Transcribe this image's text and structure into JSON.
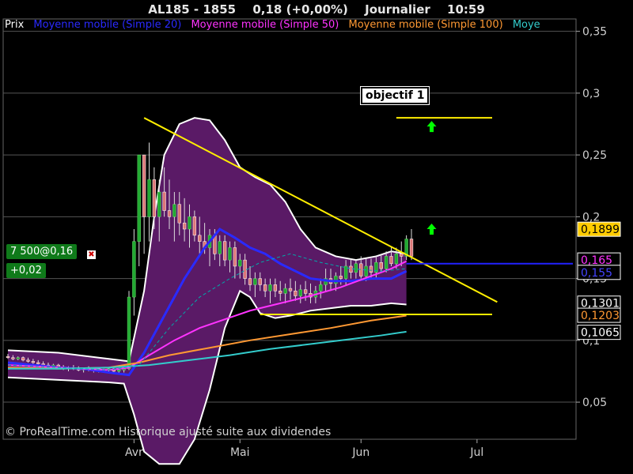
{
  "header": {
    "symbol": "AL185 - 1855",
    "price_change": "0,18 (+0,00%)",
    "period": "Journalier",
    "time": "10:59"
  },
  "legend": {
    "items": [
      {
        "label": "Prix",
        "color": "#ffffff"
      },
      {
        "label": "Moyenne mobile (Simple 20)",
        "color": "#2a2aff"
      },
      {
        "label": "Moyenne mobile (Simple 50)",
        "color": "#ff33ff"
      },
      {
        "label": "Moyenne mobile (Simple 100)",
        "color": "#ff9933"
      },
      {
        "label": "Moye",
        "color": "#33cccc"
      }
    ]
  },
  "order_box": {
    "label": "7 500@0,16",
    "change": "+0,02"
  },
  "annotation": {
    "label": "objectif 1"
  },
  "copyright": "© ProRealTime.com Historique ajusté suite aux dividendes",
  "chart_data": {
    "type": "candlestick",
    "y_axis": {
      "ylim": [
        0.02,
        0.36
      ],
      "ticks": [
        {
          "value": 0.35,
          "label": "0,35"
        },
        {
          "value": 0.3,
          "label": "0,3"
        },
        {
          "value": 0.25,
          "label": "0,25"
        },
        {
          "value": 0.2,
          "label": "0,2"
        },
        {
          "value": 0.15,
          "label": "0,15"
        },
        {
          "value": 0.1,
          "label": "0,1"
        },
        {
          "value": 0.05,
          "label": "0,05"
        }
      ]
    },
    "x_axis": {
      "ticks": [
        {
          "label": "Avr",
          "index": 25
        },
        {
          "label": "Mai",
          "index": 46
        },
        {
          "label": "Jun",
          "index": 70
        },
        {
          "label": "Jul",
          "index": 93
        }
      ],
      "range": [
        0,
        112
      ]
    },
    "price_labels": [
      {
        "value": 0.1899,
        "label": "0,1899",
        "bg": "#ffcc00",
        "fg": "#000000"
      },
      {
        "value": 0.165,
        "label": "0,165",
        "bg": "#000000",
        "fg": "#ff33ff"
      },
      {
        "value": 0.155,
        "label": "0,155",
        "bg": "#000000",
        "fg": "#4444ff"
      },
      {
        "value": 0.1301,
        "label": "0,1301",
        "bg": "#000000",
        "fg": "#ffffff"
      },
      {
        "value": 0.1203,
        "label": "0,1203",
        "bg": "#000000",
        "fg": "#ff9933"
      },
      {
        "value": 0.1065,
        "label": "0,1065",
        "bg": "#000000",
        "fg": "#ffffff"
      }
    ],
    "candles": [
      [
        0.087,
        0.089,
        0.085,
        0.086
      ],
      [
        0.086,
        0.088,
        0.084,
        0.085
      ],
      [
        0.085,
        0.087,
        0.084,
        0.086
      ],
      [
        0.086,
        0.087,
        0.083,
        0.084
      ],
      [
        0.084,
        0.086,
        0.082,
        0.083
      ],
      [
        0.083,
        0.085,
        0.081,
        0.082
      ],
      [
        0.082,
        0.084,
        0.08,
        0.081
      ],
      [
        0.081,
        0.083,
        0.079,
        0.08
      ],
      [
        0.08,
        0.082,
        0.078,
        0.079
      ],
      [
        0.079,
        0.081,
        0.077,
        0.08
      ],
      [
        0.08,
        0.081,
        0.077,
        0.078
      ],
      [
        0.078,
        0.08,
        0.076,
        0.077
      ],
      [
        0.077,
        0.079,
        0.075,
        0.078
      ],
      [
        0.078,
        0.08,
        0.076,
        0.077
      ],
      [
        0.077,
        0.079,
        0.075,
        0.076
      ],
      [
        0.076,
        0.078,
        0.074,
        0.077
      ],
      [
        0.077,
        0.079,
        0.075,
        0.076
      ],
      [
        0.076,
        0.078,
        0.074,
        0.077
      ],
      [
        0.077,
        0.078,
        0.074,
        0.075
      ],
      [
        0.075,
        0.077,
        0.074,
        0.076
      ],
      [
        0.076,
        0.078,
        0.074,
        0.077
      ],
      [
        0.077,
        0.078,
        0.074,
        0.075
      ],
      [
        0.075,
        0.077,
        0.073,
        0.076
      ],
      [
        0.076,
        0.078,
        0.074,
        0.077
      ],
      [
        0.077,
        0.14,
        0.076,
        0.135
      ],
      [
        0.135,
        0.19,
        0.12,
        0.18
      ],
      [
        0.18,
        0.25,
        0.16,
        0.25
      ],
      [
        0.25,
        0.25,
        0.17,
        0.2
      ],
      [
        0.2,
        0.26,
        0.18,
        0.23
      ],
      [
        0.23,
        0.24,
        0.19,
        0.2
      ],
      [
        0.2,
        0.23,
        0.18,
        0.22
      ],
      [
        0.22,
        0.24,
        0.2,
        0.205
      ],
      [
        0.205,
        0.23,
        0.19,
        0.2
      ],
      [
        0.2,
        0.22,
        0.18,
        0.21
      ],
      [
        0.21,
        0.22,
        0.185,
        0.195
      ],
      [
        0.195,
        0.215,
        0.18,
        0.19
      ],
      [
        0.19,
        0.21,
        0.175,
        0.2
      ],
      [
        0.2,
        0.205,
        0.18,
        0.185
      ],
      [
        0.185,
        0.2,
        0.17,
        0.18
      ],
      [
        0.18,
        0.195,
        0.17,
        0.175
      ],
      [
        0.175,
        0.19,
        0.16,
        0.185
      ],
      [
        0.185,
        0.19,
        0.165,
        0.17
      ],
      [
        0.17,
        0.185,
        0.16,
        0.18
      ],
      [
        0.18,
        0.185,
        0.16,
        0.165
      ],
      [
        0.165,
        0.18,
        0.155,
        0.175
      ],
      [
        0.175,
        0.18,
        0.15,
        0.16
      ],
      [
        0.16,
        0.17,
        0.15,
        0.165
      ],
      [
        0.165,
        0.17,
        0.145,
        0.15
      ],
      [
        0.15,
        0.16,
        0.14,
        0.145
      ],
      [
        0.145,
        0.155,
        0.135,
        0.15
      ],
      [
        0.15,
        0.155,
        0.14,
        0.145
      ],
      [
        0.145,
        0.15,
        0.135,
        0.14
      ],
      [
        0.14,
        0.15,
        0.13,
        0.145
      ],
      [
        0.145,
        0.15,
        0.135,
        0.14
      ],
      [
        0.14,
        0.148,
        0.132,
        0.138
      ],
      [
        0.138,
        0.146,
        0.13,
        0.142
      ],
      [
        0.142,
        0.15,
        0.133,
        0.14
      ],
      [
        0.14,
        0.148,
        0.132,
        0.136
      ],
      [
        0.136,
        0.145,
        0.13,
        0.141
      ],
      [
        0.141,
        0.148,
        0.132,
        0.138
      ],
      [
        0.138,
        0.146,
        0.13,
        0.135
      ],
      [
        0.135,
        0.144,
        0.13,
        0.14
      ],
      [
        0.14,
        0.15,
        0.134,
        0.145
      ],
      [
        0.145,
        0.158,
        0.14,
        0.15
      ],
      [
        0.15,
        0.158,
        0.14,
        0.146
      ],
      [
        0.146,
        0.155,
        0.14,
        0.152
      ],
      [
        0.152,
        0.16,
        0.145,
        0.15
      ],
      [
        0.15,
        0.165,
        0.145,
        0.16
      ],
      [
        0.16,
        0.166,
        0.15,
        0.155
      ],
      [
        0.155,
        0.165,
        0.15,
        0.162
      ],
      [
        0.162,
        0.168,
        0.15,
        0.152
      ],
      [
        0.152,
        0.166,
        0.148,
        0.16
      ],
      [
        0.16,
        0.166,
        0.15,
        0.155
      ],
      [
        0.155,
        0.168,
        0.15,
        0.163
      ],
      [
        0.163,
        0.17,
        0.155,
        0.158
      ],
      [
        0.158,
        0.172,
        0.155,
        0.168
      ],
      [
        0.168,
        0.175,
        0.16,
        0.162
      ],
      [
        0.162,
        0.175,
        0.158,
        0.17
      ],
      [
        0.17,
        0.18,
        0.16,
        0.168
      ],
      [
        0.168,
        0.185,
        0.165,
        0.182
      ],
      [
        0.182,
        0.19,
        0.165,
        0.168
      ]
    ],
    "series": [
      {
        "name": "Moyenne mobile (Simple 20)",
        "color": "#2a2aff",
        "points": [
          [
            0,
            0.082
          ],
          [
            5,
            0.08
          ],
          [
            10,
            0.078
          ],
          [
            15,
            0.077
          ],
          [
            20,
            0.074
          ],
          [
            24,
            0.072
          ],
          [
            27,
            0.09
          ],
          [
            31,
            0.12
          ],
          [
            35,
            0.15
          ],
          [
            39,
            0.175
          ],
          [
            42,
            0.19
          ],
          [
            45,
            0.183
          ],
          [
            48,
            0.175
          ],
          [
            51,
            0.17
          ],
          [
            54,
            0.162
          ],
          [
            57,
            0.156
          ],
          [
            60,
            0.15
          ],
          [
            64,
            0.148
          ],
          [
            68,
            0.148
          ],
          [
            72,
            0.15
          ],
          [
            76,
            0.15
          ],
          [
            79,
            0.156
          ]
        ]
      },
      {
        "name": "Moyenne mobile (Simple 50)",
        "color": "#ff33ff",
        "points": [
          [
            0,
            0.08
          ],
          [
            10,
            0.078
          ],
          [
            20,
            0.076
          ],
          [
            24,
            0.078
          ],
          [
            28,
            0.088
          ],
          [
            33,
            0.1
          ],
          [
            38,
            0.11
          ],
          [
            43,
            0.117
          ],
          [
            48,
            0.124
          ],
          [
            54,
            0.13
          ],
          [
            60,
            0.136
          ],
          [
            66,
            0.143
          ],
          [
            72,
            0.152
          ],
          [
            76,
            0.158
          ],
          [
            79,
            0.164
          ]
        ]
      },
      {
        "name": "Moyenne mobile (Simple 100)",
        "color": "#ff9933",
        "points": [
          [
            0,
            0.078
          ],
          [
            10,
            0.077
          ],
          [
            20,
            0.078
          ],
          [
            26,
            0.082
          ],
          [
            32,
            0.088
          ],
          [
            40,
            0.094
          ],
          [
            48,
            0.1
          ],
          [
            56,
            0.105
          ],
          [
            64,
            0.11
          ],
          [
            72,
            0.116
          ],
          [
            79,
            0.12
          ]
        ]
      },
      {
        "name": "Moye",
        "color": "#33cccc",
        "points": [
          [
            0,
            0.077
          ],
          [
            10,
            0.077
          ],
          [
            20,
            0.078
          ],
          [
            28,
            0.08
          ],
          [
            36,
            0.084
          ],
          [
            44,
            0.088
          ],
          [
            52,
            0.093
          ],
          [
            60,
            0.097
          ],
          [
            68,
            0.101
          ],
          [
            74,
            0.104
          ],
          [
            79,
            0.107
          ]
        ]
      },
      {
        "name": "band_mid",
        "color": "#00aaaa",
        "dash": true,
        "points": [
          [
            0,
            0.08
          ],
          [
            10,
            0.078
          ],
          [
            20,
            0.076
          ],
          [
            26,
            0.08
          ],
          [
            32,
            0.11
          ],
          [
            38,
            0.135
          ],
          [
            44,
            0.15
          ],
          [
            50,
            0.163
          ],
          [
            56,
            0.17
          ],
          [
            62,
            0.163
          ],
          [
            68,
            0.158
          ],
          [
            74,
            0.156
          ],
          [
            79,
            0.158
          ]
        ]
      }
    ],
    "bands": {
      "upper": [
        [
          0,
          0.092
        ],
        [
          10,
          0.09
        ],
        [
          20,
          0.085
        ],
        [
          24,
          0.083
        ],
        [
          27,
          0.14
        ],
        [
          29,
          0.2
        ],
        [
          31,
          0.25
        ],
        [
          34,
          0.275
        ],
        [
          37,
          0.28
        ],
        [
          40,
          0.278
        ],
        [
          43,
          0.262
        ],
        [
          46,
          0.24
        ],
        [
          49,
          0.232
        ],
        [
          52,
          0.226
        ],
        [
          55,
          0.212
        ],
        [
          58,
          0.19
        ],
        [
          61,
          0.175
        ],
        [
          65,
          0.168
        ],
        [
          69,
          0.165
        ],
        [
          73,
          0.168
        ],
        [
          76,
          0.172
        ],
        [
          79,
          0.17
        ]
      ],
      "lower": [
        [
          0,
          0.07
        ],
        [
          10,
          0.068
        ],
        [
          20,
          0.066
        ],
        [
          23,
          0.065
        ],
        [
          25,
          0.04
        ],
        [
          27,
          0.01
        ],
        [
          30,
          0.0
        ],
        [
          34,
          0.0
        ],
        [
          37,
          0.02
        ],
        [
          40,
          0.06
        ],
        [
          43,
          0.11
        ],
        [
          46,
          0.14
        ],
        [
          48,
          0.135
        ],
        [
          50,
          0.122
        ],
        [
          53,
          0.118
        ],
        [
          56,
          0.12
        ],
        [
          60,
          0.124
        ],
        [
          64,
          0.126
        ],
        [
          68,
          0.128
        ],
        [
          72,
          0.128
        ],
        [
          76,
          0.13
        ],
        [
          79,
          0.129
        ]
      ]
    },
    "lines": [
      {
        "name": "trendline",
        "color": "#ffee00",
        "x1": 27,
        "y1": 0.28,
        "x2": 97,
        "y2": 0.131
      },
      {
        "name": "support",
        "color": "#ffee00",
        "x1": 50,
        "y1": 0.121,
        "x2": 96,
        "y2": 0.121
      },
      {
        "name": "objectif",
        "color": "#ffee00",
        "x1": 77,
        "y1": 0.28,
        "x2": 96,
        "y2": 0.28
      },
      {
        "name": "current",
        "color": "#2222ff",
        "x1": 79,
        "y1": 0.162,
        "x2": 112,
        "y2": 0.162
      }
    ],
    "arrows": [
      {
        "x": 84,
        "y": 0.273,
        "color": "#00ff00"
      },
      {
        "x": 84,
        "y": 0.19,
        "color": "#00ff00"
      }
    ]
  }
}
